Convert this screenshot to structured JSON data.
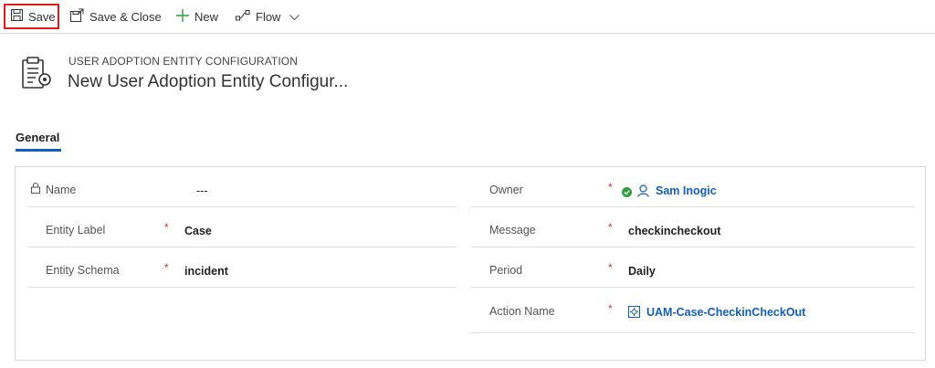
{
  "toolbar": {
    "save_label": "Save",
    "save_close_label": "Save & Close",
    "new_label": "New",
    "flow_label": "Flow"
  },
  "header": {
    "entity_type": "USER ADOPTION ENTITY CONFIGURATION",
    "record_title": "New User Adoption Entity Configur..."
  },
  "tabs": [
    {
      "label": "General"
    }
  ],
  "form": {
    "left": [
      {
        "label": "Name",
        "value": "---",
        "required": ""
      },
      {
        "label": "Entity Label",
        "value": "Case",
        "required": "*"
      },
      {
        "label": "Entity Schema",
        "value": "incident",
        "required": "*"
      }
    ],
    "right": [
      {
        "label": "Owner",
        "value": "Sam Inogic",
        "required": "*"
      },
      {
        "label": "Message",
        "value": "checkincheckout",
        "required": "*"
      },
      {
        "label": "Period",
        "value": "Daily",
        "required": "*"
      },
      {
        "label": "Action Name",
        "value": "UAM-Case-CheckinCheckOut",
        "required": "*"
      }
    ]
  },
  "colors": {
    "accent": "#1060c0",
    "required": "#d13438",
    "highlight": "#e0191e",
    "status_ok": "#2e9e3a"
  },
  "icons": [
    "save-icon",
    "save-close-icon",
    "plus-icon",
    "flow-icon",
    "chevron-down-icon",
    "entity-icon",
    "lock-icon",
    "status-available-icon",
    "user-icon",
    "process-icon"
  ]
}
